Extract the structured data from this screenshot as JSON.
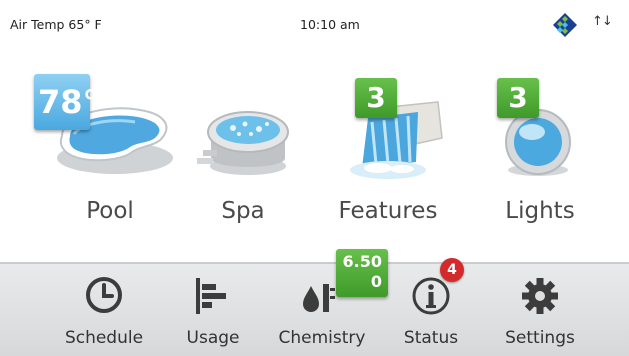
{
  "header": {
    "air_temp": "Air Temp 65° F",
    "time": "10:10 am",
    "logo_icon": "brand-diamond-logo",
    "network_icon": "up-down-arrows-icon",
    "network_glyph": "↑↓"
  },
  "tiles": [
    {
      "label": "Pool",
      "badge": "78°",
      "icon": "pool-icon"
    },
    {
      "label": "Spa",
      "icon": "spa-icon"
    },
    {
      "label": "Features",
      "badge": "3",
      "icon": "waterfall-icon"
    },
    {
      "label": "Lights",
      "badge": "3",
      "icon": "light-icon"
    }
  ],
  "nav": [
    {
      "label": "Schedule",
      "icon": "clock-icon"
    },
    {
      "label": "Usage",
      "icon": "bar-chart-icon"
    },
    {
      "label": "Chemistry",
      "icon": "chemistry-icon",
      "badge_line1": "6.50",
      "badge_line2": "0"
    },
    {
      "label": "Status",
      "icon": "info-icon",
      "alert_count": "4"
    },
    {
      "label": "Settings",
      "icon": "gear-icon"
    }
  ],
  "colors": {
    "badge_green": "#4caf32",
    "badge_blue": "#5ab4e6",
    "alert_red": "#d32b2b",
    "nav_bg": "#e0e1e3"
  }
}
